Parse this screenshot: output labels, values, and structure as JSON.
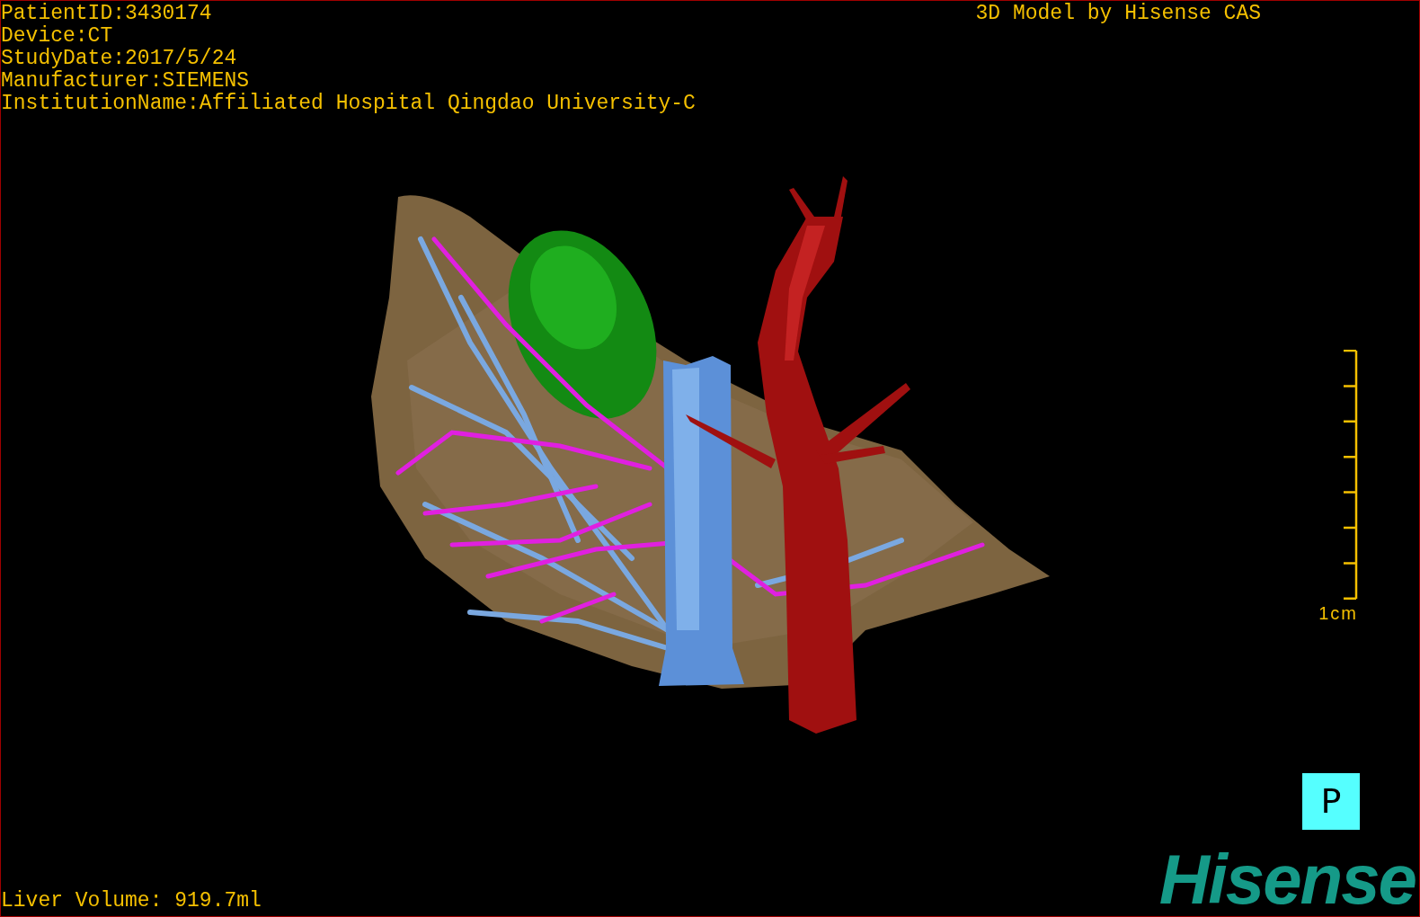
{
  "info_lines": [
    "PatientID:3430174",
    "Device:CT",
    "StudyDate:2017/5/24",
    "Manufacturer:SIEMENS",
    "InstitutionName:Affiliated Hospital Qingdao University-C"
  ],
  "title": "3D Model by Hisense CAS",
  "scale_bar": {
    "label": "1cm"
  },
  "orientation_marker": "P",
  "liver_volume": "Liver Volume: 919.7ml",
  "logo": "Hisense"
}
